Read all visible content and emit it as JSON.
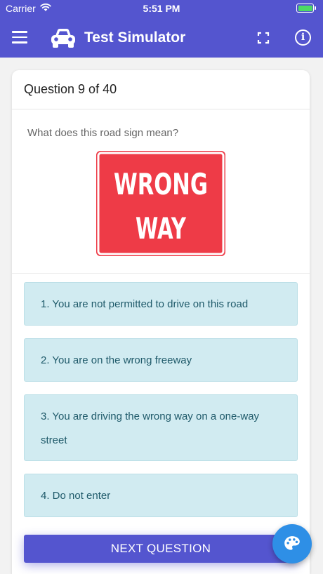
{
  "status_bar": {
    "carrier": "Carrier",
    "time": "5:51 PM",
    "wifi_icon": "wifi-icon",
    "battery_icon": "battery-icon"
  },
  "navbar": {
    "title": "Test Simulator",
    "menu_icon": "menu-icon",
    "logo_icon": "car-icon",
    "fullscreen_icon": "fullscreen-icon",
    "info_icon": "info-icon",
    "info_glyph": "i",
    "background_color": "#5455cf"
  },
  "question": {
    "counter": "Question 9 of 40",
    "text": "What does this road sign mean?",
    "sign": {
      "line1": "WRONG",
      "line2": "WAY",
      "color": "#ee3b47"
    }
  },
  "answers": [
    {
      "label": "1. You are not permitted to drive on this road"
    },
    {
      "label": "2. You are on the wrong freeway"
    },
    {
      "label": "3. You are driving the wrong way on a one-way street"
    },
    {
      "label": "4. Do not enter"
    }
  ],
  "actions": {
    "next_label": "NEXT QUESTION",
    "palette_icon": "palette-icon"
  },
  "colors": {
    "accent": "#5455cf",
    "answer_bg": "#d1ebf1",
    "answer_text": "#1f5a6a",
    "fab": "#2e8fe6"
  }
}
